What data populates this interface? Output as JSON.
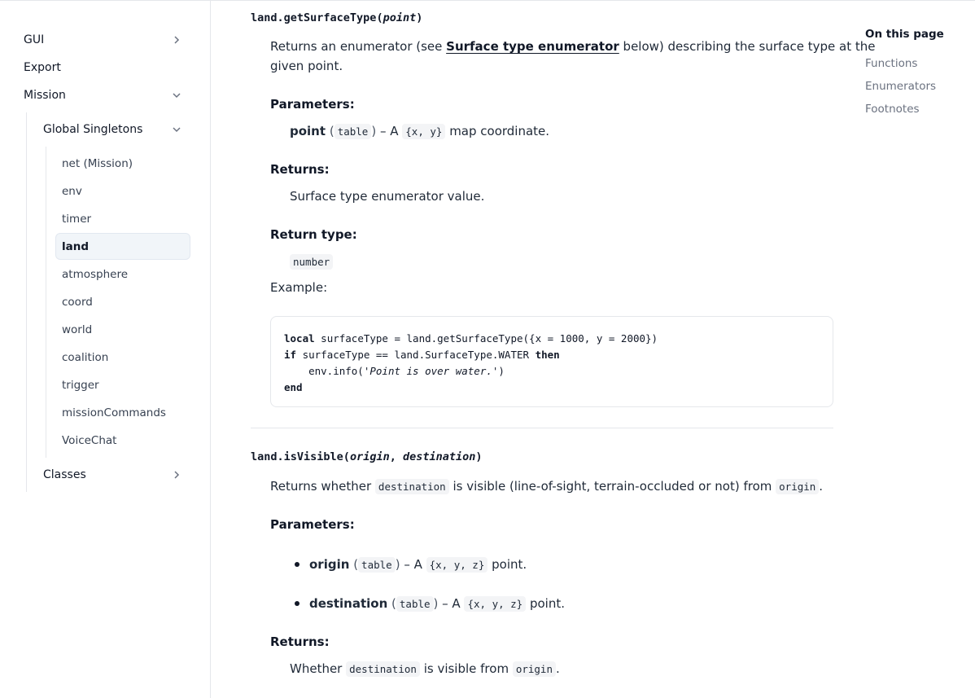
{
  "sidebar": {
    "gui": "GUI",
    "export": "Export",
    "mission": "Mission",
    "global_singletons": "Global Singletons",
    "items": [
      "net (Mission)",
      "env",
      "timer",
      "land",
      "atmosphere",
      "coord",
      "world",
      "coalition",
      "trigger",
      "missionCommands",
      "VoiceChat"
    ],
    "classes": "Classes",
    "active": "land"
  },
  "main": {
    "f1": {
      "name": "land.getSurfaceType",
      "open": "(",
      "param": "point",
      "close": ")",
      "desc_pre": "Returns an enumerator (see ",
      "desc_link": "Surface type enumerator",
      "desc_post": " below) describing the surface type at the",
      "desc_line2": "given point.",
      "params_heading": "Parameters:",
      "param_name": "point",
      "param_type": "table",
      "param_sep": " – A ",
      "param_code": "{x, y}",
      "param_desc": " map coordinate.",
      "returns_heading": "Returns:",
      "returns_text": "Surface type enumerator value.",
      "rtype_heading": "Return type:",
      "rtype": "number",
      "example_heading": "Example:",
      "code": {
        "l1_kw": "local",
        "l1_rest": " surfaceType = land.getSurfaceType({x = 1000, y = 2000})",
        "l2_kw": "if",
        "l2_mid": " surfaceType == land.SurfaceType.WATER ",
        "l2_kw2": "then",
        "l3_pre": "    env.info(",
        "l3_str": "'Point is over water.'",
        "l3_post": ")",
        "l4_kw": "end"
      }
    },
    "f2": {
      "name": "land.isVisible",
      "open": "(",
      "param1": "origin",
      "comma": ", ",
      "param2": "destination",
      "close": ")",
      "desc_pre": "Returns whether ",
      "desc_code1": "destination",
      "desc_mid": " is visible (line-of-sight, terrain-occluded or not) from ",
      "desc_code2": "origin",
      "desc_post": ".",
      "params_heading": "Parameters:",
      "p1_name": "origin",
      "p1_type": "table",
      "p1_code": "{x, y, z}",
      "p1_desc": " point.",
      "p2_name": "destination",
      "p2_type": "table",
      "p2_code": "{x, y, z}",
      "p2_desc": " point.",
      "sep": " – A ",
      "paren_open": "(",
      "paren_close": ")",
      "returns_heading": "Returns:",
      "ret_pre": "Whether ",
      "ret_code1": "destination",
      "ret_mid": " is visible from ",
      "ret_code2": "origin",
      "ret_post": "."
    }
  },
  "toc": {
    "title": "On this page",
    "items": [
      "Functions",
      "Enumerators",
      "Footnotes"
    ]
  }
}
